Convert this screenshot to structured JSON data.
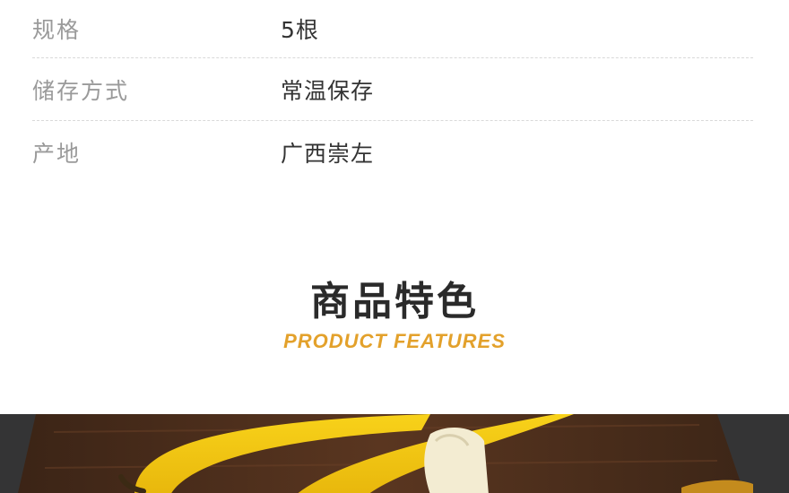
{
  "specs": [
    {
      "key": "规格",
      "value": "5根"
    },
    {
      "key": "储存方式",
      "value": "常温保存"
    },
    {
      "key": "产地",
      "value": "广西崇左"
    }
  ],
  "features": {
    "title": "商品特色",
    "subtitle": "PRODUCT FEATURES"
  },
  "colors": {
    "accent": "#e3a12b",
    "title": "#2a2a2a",
    "label": "#9a9a9a"
  },
  "hero_image": {
    "icon": "banana-photo"
  }
}
